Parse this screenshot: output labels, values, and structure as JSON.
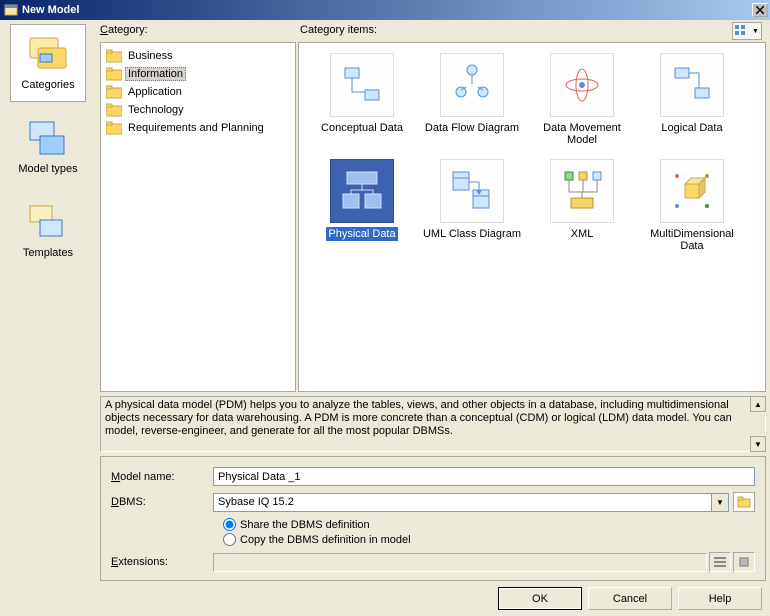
{
  "window": {
    "title": "New Model"
  },
  "labels": {
    "category": "Category:",
    "category_items": "Category items:"
  },
  "left_nav": [
    {
      "id": "categories",
      "label": "Categories",
      "selected": true
    },
    {
      "id": "model-types",
      "label": "Model types",
      "selected": false
    },
    {
      "id": "templates",
      "label": "Templates",
      "selected": false
    }
  ],
  "tree": [
    {
      "id": "business",
      "label": "Business",
      "selected": false
    },
    {
      "id": "information",
      "label": "Information",
      "selected": true
    },
    {
      "id": "application",
      "label": "Application",
      "selected": false
    },
    {
      "id": "technology",
      "label": "Technology",
      "selected": false
    },
    {
      "id": "requirements",
      "label": "Requirements and Planning",
      "selected": false
    }
  ],
  "items": [
    {
      "id": "conceptual-data",
      "label": "Conceptual Data",
      "selected": false
    },
    {
      "id": "data-flow-diagram",
      "label": "Data Flow Diagram",
      "selected": false
    },
    {
      "id": "data-movement-model",
      "label": "Data Movement Model",
      "selected": false
    },
    {
      "id": "logical-data",
      "label": "Logical Data",
      "selected": false
    },
    {
      "id": "physical-data",
      "label": "Physical Data",
      "selected": true
    },
    {
      "id": "uml-class-diagram",
      "label": "UML Class Diagram",
      "selected": false
    },
    {
      "id": "xml",
      "label": "XML",
      "selected": false
    },
    {
      "id": "multidimensional-data",
      "label": "MultiDimensional Data",
      "selected": false
    }
  ],
  "description": "A physical data model (PDM) helps you to analyze the tables, views, and other objects in a database, including multidimensional objects necessary for data warehousing. A PDM is more concrete than a conceptual (CDM) or logical (LDM) data model. You can model, reverse-engineer, and generate for all the most popular DBMSs.",
  "form": {
    "model_name_label": "Model name:",
    "model_name_value": "Physical Data _1",
    "dbms_label": "DBMS:",
    "dbms_value": "Sybase IQ 15.2",
    "radio_share": "Share the DBMS definition",
    "radio_copy": "Copy the DBMS definition in model",
    "radio_selected": "share",
    "extensions_label": "Extensions:",
    "extensions_value": ""
  },
  "buttons": {
    "ok": "OK",
    "cancel": "Cancel",
    "help": "Help"
  }
}
